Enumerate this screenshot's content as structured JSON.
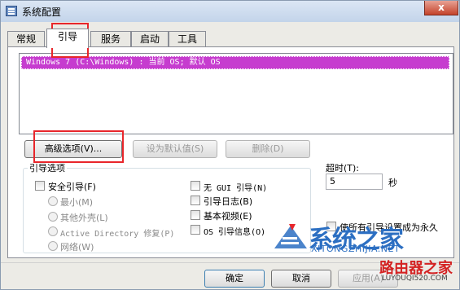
{
  "window": {
    "title": "系统配置",
    "close_glyph": "x"
  },
  "tabs": [
    {
      "label": "常规"
    },
    {
      "label": "引导"
    },
    {
      "label": "服务"
    },
    {
      "label": "启动"
    },
    {
      "label": "工具"
    }
  ],
  "os_list": {
    "entries": [
      "Windows 7 (C:\\Windows) : 当前 OS; 默认 OS"
    ]
  },
  "buttons": {
    "advanced": "高级选项(V)...",
    "set_default": "设为默认值(S)",
    "delete": "删除(D)",
    "ok": "确定",
    "cancel": "取消",
    "apply": "应用(A)"
  },
  "boot_options": {
    "group_title": "引导选项",
    "safe_boot": "安全引导(F)",
    "minimal": "最小(M)",
    "alternate_shell": "其他外壳(L)",
    "active_directory_repair": "Active Directory 修复(P)",
    "network": "网络(W)",
    "no_gui_boot": "无 GUI 引导(N)",
    "boot_log": "引导日志(B)",
    "base_video": "基本视频(E)",
    "os_boot_info": "OS 引导信息(O)"
  },
  "timeout": {
    "label": "超时(T):",
    "value": "5",
    "unit": "秒",
    "make_permanent": "使所有引导设置成为永久"
  },
  "watermarks": {
    "brand": "系统之家",
    "brand_url": "XITONGZHIJIA.NET",
    "brand2": "路由器之家",
    "brand2_url": "LUYOUQI520.COM"
  },
  "colors": {
    "selection": "#c63ccf",
    "highlight_box": "#e8262b"
  }
}
